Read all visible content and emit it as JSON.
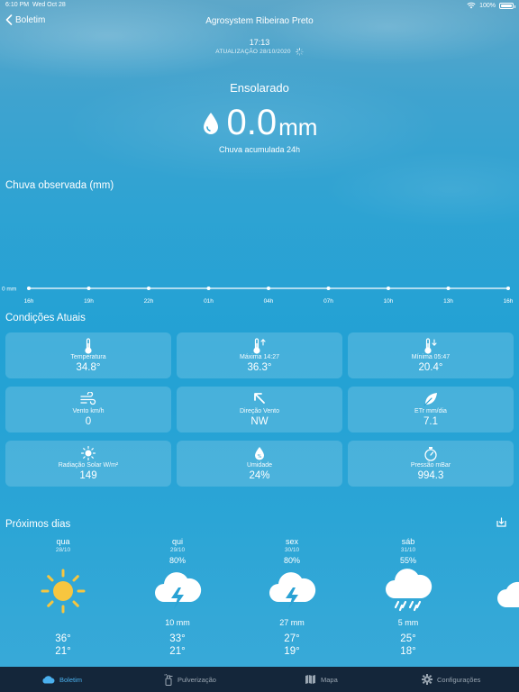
{
  "status_bar": {
    "time": "6:10 PM",
    "date": "Wed Oct 28",
    "battery": "100%"
  },
  "nav": {
    "back_label": "Boletim",
    "title": "Agrosystem Ribeirao Preto"
  },
  "update": {
    "time": "17:13",
    "label": "ATUALIZAÇÃO 28/10/2020"
  },
  "weather": {
    "condition": "Ensolarado",
    "rain_value": "0.0",
    "rain_unit": "mm",
    "rain_caption": "Chuva acumulada 24h"
  },
  "rain_section": {
    "title": "Chuva observada (mm)",
    "zero_label": "0 mm"
  },
  "chart_data": {
    "type": "line",
    "x": [
      "16h",
      "19h",
      "22h",
      "01h",
      "04h",
      "07h",
      "10h",
      "13h",
      "16h"
    ],
    "values": [
      0,
      0,
      0,
      0,
      0,
      0,
      0,
      0,
      0
    ],
    "ylabel": "0 mm",
    "grid": false
  },
  "current": {
    "title": "Condições Atuais",
    "cards": [
      {
        "label": "Temperatura",
        "value": "34.8°",
        "icon": "thermometer-icon"
      },
      {
        "label": "Máxima 14:27",
        "value": "36.3°",
        "icon": "thermometer-up-icon"
      },
      {
        "label": "Mínima 05:47",
        "value": "20.4°",
        "icon": "thermometer-down-icon"
      },
      {
        "label": "Vento km/h",
        "value": "0",
        "icon": "wind-icon"
      },
      {
        "label": "Direção Vento",
        "value": "NW",
        "icon": "arrow-northwest-icon"
      },
      {
        "label": "ETr mm/dia",
        "value": "7.1",
        "icon": "leaf-icon"
      },
      {
        "label": "Radiação Solar W/m²",
        "value": "149",
        "icon": "sun-icon"
      },
      {
        "label": "Umidade",
        "value": "24%",
        "icon": "humidity-drop-icon"
      },
      {
        "label": "Pressão mBar",
        "value": "994.3",
        "icon": "stopwatch-icon"
      }
    ]
  },
  "forecast": {
    "title": "Próximos dias",
    "days": [
      {
        "day": "qua",
        "date": "28/10",
        "pct": "",
        "mm": "",
        "max": "36°",
        "min": "21°",
        "icon": "sun-icon"
      },
      {
        "day": "qui",
        "date": "29/10",
        "pct": "80%",
        "mm": "10 mm",
        "max": "33°",
        "min": "21°",
        "icon": "thunderstorm-icon"
      },
      {
        "day": "sex",
        "date": "30/10",
        "pct": "80%",
        "mm": "27 mm",
        "max": "27°",
        "min": "19°",
        "icon": "thunderstorm-icon"
      },
      {
        "day": "sáb",
        "date": "31/10",
        "pct": "55%",
        "mm": "5 mm",
        "max": "25°",
        "min": "18°",
        "icon": "rain-icon"
      }
    ]
  },
  "tabs": [
    {
      "label": "Boletim",
      "icon": "cloud-icon",
      "active": true
    },
    {
      "label": "Pulverização",
      "icon": "sprayer-icon",
      "active": false
    },
    {
      "label": "Mapa",
      "icon": "map-icon",
      "active": false
    },
    {
      "label": "Configurações",
      "icon": "gear-icon",
      "active": false
    }
  ]
}
